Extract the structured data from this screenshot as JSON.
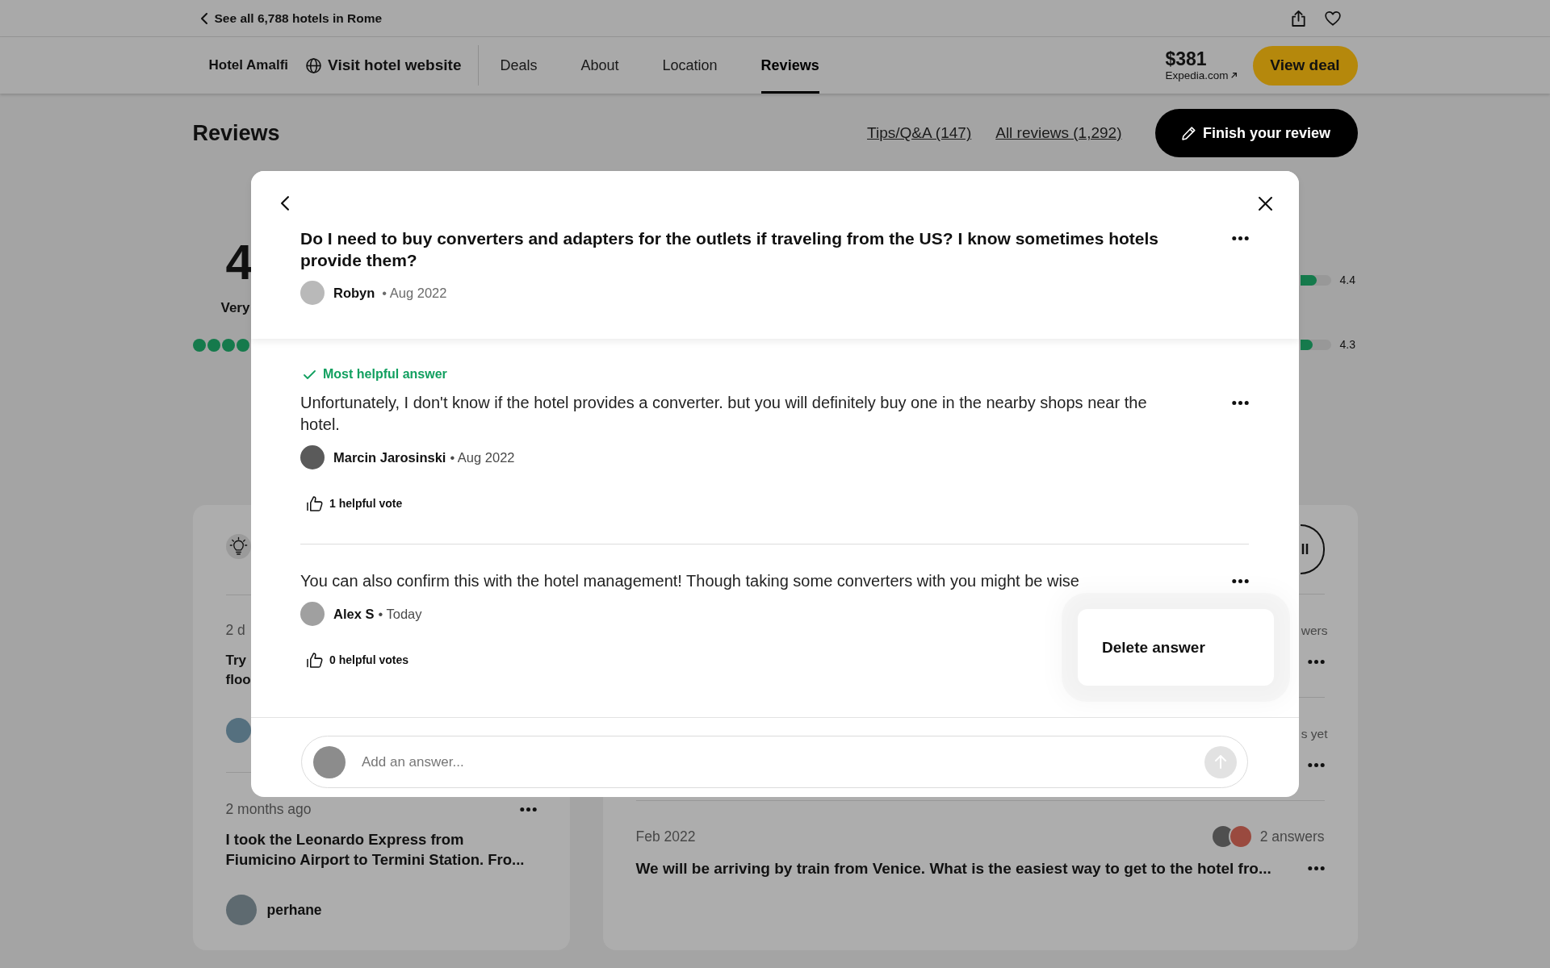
{
  "top_bar": {
    "back_link": "See all 6,788 hotels in Rome"
  },
  "hotel_nav": {
    "hotel_name": "Hotel Amalfi",
    "website_link": "Visit hotel website",
    "tabs": [
      {
        "label": "Deals",
        "selected": false
      },
      {
        "label": "About",
        "selected": false
      },
      {
        "label": "Location",
        "selected": false
      },
      {
        "label": "Reviews",
        "selected": true
      }
    ],
    "price": "$381",
    "price_source": "Expedia.com",
    "deal_button": "View deal"
  },
  "reviews_header": {
    "title": "Reviews",
    "links": [
      "Tips/Q&A (147)",
      "All reviews (1,292)"
    ],
    "write_button": "Finish your review"
  },
  "rating_summary": {
    "score": "4",
    "label": "Very",
    "stars": 4,
    "bars": [
      {
        "level": 0.54,
        "reading": "4.4"
      },
      {
        "level": 0.41,
        "reading": "4.3"
      }
    ]
  },
  "questions_card": {
    "items": [
      {
        "kind": "clipped",
        "time": "2 d",
        "title": "Try floo"
      },
      {
        "kind": "full",
        "time": "2 months ago",
        "title": "I took the Leonardo Express from Fiumicino Airport to Termini Station. Fro...",
        "author": "perhane"
      }
    ]
  },
  "answers_card": {
    "button": "ll",
    "items": [
      {
        "kind": "clipped",
        "answers": "wers"
      },
      {
        "kind": "clipped",
        "answers": "s yet"
      },
      {
        "kind": "full",
        "date": "Feb 2022",
        "answers": "2 answers",
        "title": "We will be arriving by train from Venice. What is the easiest way to get to the hotel fro..."
      }
    ]
  },
  "question_dialog": {
    "question": "Do I need to buy converters and adapters for the outlets if traveling from the US? I know sometimes hotels provide them?",
    "author": "Robyn",
    "date": "• Aug 2022",
    "answers": [
      {
        "badge": "Most helpful answer",
        "text": "Unfortunately, I don't know if the hotel provides a converter. but you will definitely buy one in the nearby shops near the hotel.",
        "author": "Marcin Jarosinski",
        "date": "• Aug 2022",
        "votes": "1 helpful vote"
      },
      {
        "text": "You can also confirm this with the hotel management! Though taking some converters with you might be wise",
        "author": "Alex S",
        "date": "• Today",
        "votes": "0 helpful votes",
        "menu": [
          "Delete answer"
        ]
      }
    ],
    "answer_input": {
      "placeholder": "Add an answer..."
    }
  }
}
